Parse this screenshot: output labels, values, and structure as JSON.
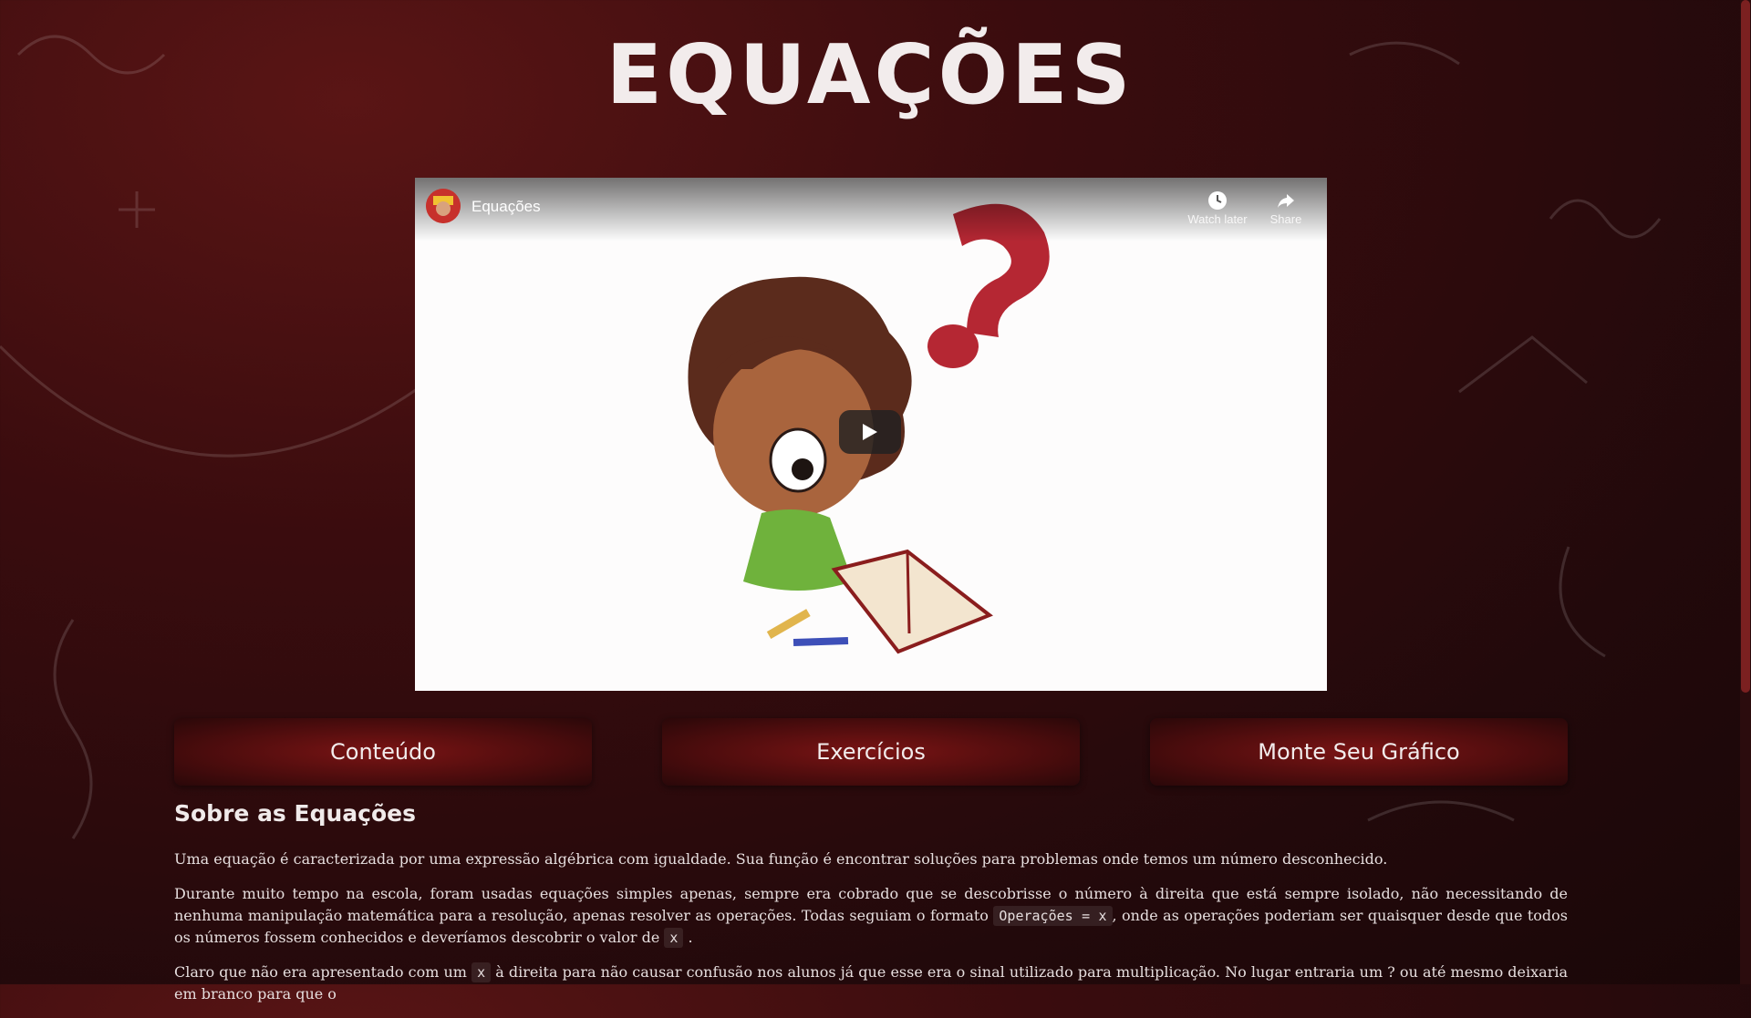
{
  "logo": {
    "text": "EQUAÇÕES"
  },
  "video": {
    "title": "Equações",
    "watch_later_label": "Watch later",
    "share_label": "Share"
  },
  "nav": [
    {
      "label": "Conteúdo"
    },
    {
      "label": "Exercícios"
    },
    {
      "label": "Monte Seu Gráfico"
    }
  ],
  "article": {
    "heading": "Sobre as Equações",
    "p1": "Uma equação é caracterizada por uma expressão algébrica com igualdade. Sua função é encontrar soluções para problemas onde temos um número desconhecido.",
    "p2_part1": "Durante muito tempo na escola, foram usadas equações simples apenas, sempre era cobrado que se descobrisse o número à direita que está sempre isolado, não necessitando de nenhuma manipulação matemática para a resolução, apenas resolver as operações. Todas seguiam o formato",
    "p2_code1": "Operações = x",
    "p2_part2": ", onde as operações poderiam ser quaisquer desde que todos os números fossem conhecidos e deveríamos descobrir o valor de",
    "p2_code2": "x",
    "p2_part3": ".",
    "p3_part1": "Claro que não era apresentado com um",
    "p3_code1": "x",
    "p3_part2": "à direita para não causar confusão nos alunos já que esse era o sinal utilizado para multiplicação. No lugar entraria um ? ou até mesmo deixaria em branco para que o"
  },
  "colors": {
    "background": "#3a0c0e",
    "nav_button": "#7a1414",
    "text": "#e6dede",
    "accent": "#b3202e"
  },
  "icons": {
    "watch_later": "clock-icon",
    "share": "share-arrow-icon",
    "play": "play-icon"
  }
}
